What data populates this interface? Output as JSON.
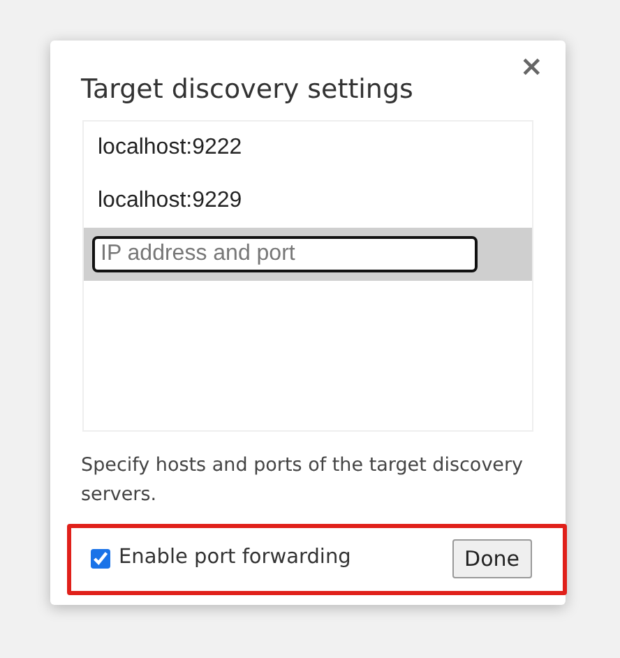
{
  "dialog": {
    "title": "Target discovery settings",
    "close": "×"
  },
  "targets": [
    {
      "value": "localhost:9222",
      "selected": false
    },
    {
      "value": "localhost:9229",
      "selected": false
    }
  ],
  "new_target": {
    "placeholder": "IP address and port",
    "selected": true
  },
  "help": "Specify hosts and ports of the target discovery servers.",
  "footer": {
    "highlighted": true,
    "port_forwarding": {
      "label": "Enable port forwarding",
      "checked": true
    },
    "done": "Done"
  }
}
